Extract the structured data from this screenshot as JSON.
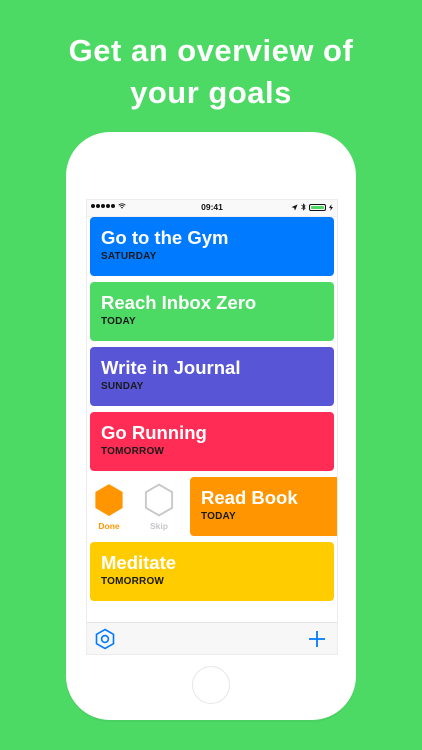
{
  "headline": {
    "line1": "Get an overview of",
    "line2": "your goals"
  },
  "status_bar": {
    "time": "09:41",
    "battery_level": 1.0
  },
  "goals": [
    {
      "title": "Go to the Gym",
      "day": "SATURDAY",
      "color": "#007aff"
    },
    {
      "title": "Reach Inbox Zero",
      "day": "TODAY",
      "color": "#4cd964"
    },
    {
      "title": "Write in Journal",
      "day": "SUNDAY",
      "color": "#5856d6"
    },
    {
      "title": "Go Running",
      "day": "TOMORROW",
      "color": "#ff2d55"
    },
    {
      "title": "Read Book",
      "day": "TODAY",
      "color": "#ff9500"
    },
    {
      "title": "Meditate",
      "day": "TOMORROW",
      "color": "#ffcc00"
    }
  ],
  "swipe_actions": {
    "done_label": "Done",
    "skip_label": "Skip",
    "done_color": "#ff9500",
    "skip_color": "#c7c7cc"
  },
  "tab_bar": {
    "settings_icon": "hexagon-settings-icon",
    "add_icon": "plus-icon",
    "accent": "#007aff"
  },
  "colors": {
    "background": "#4cd964"
  }
}
